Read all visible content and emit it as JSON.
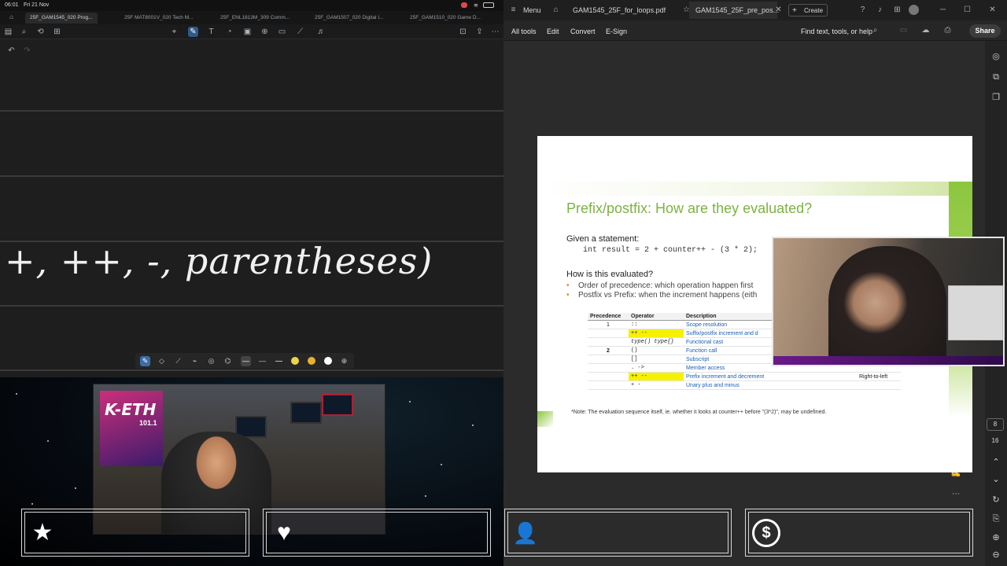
{
  "ipad": {
    "status": {
      "time": "06:01",
      "date": "Fri 21 Nov"
    },
    "tabs": [
      "25F_GAM1545_020 Prog...",
      "25F MAT8001V_020 Tech M...",
      "25F_ENL1813M_309 Comm...",
      "25F_GAM1507_020 Digital I...",
      "25F_GAM1510_020 Game D..."
    ],
    "handwriting": "+, ++, -, parentheses)",
    "pen_colors": [
      "#f0d24a",
      "#e6b030",
      "#ffffff"
    ]
  },
  "stream": {
    "radio_logo": "K-ETH",
    "radio_freq": "101.1",
    "cards": [
      {
        "icon": "star-icon",
        "glyph": "★"
      },
      {
        "icon": "heart-icon",
        "glyph": "♥"
      },
      {
        "icon": "add-user-icon",
        "glyph": "👤"
      },
      {
        "icon": "dollar-icon",
        "glyph": "$"
      }
    ]
  },
  "pdf": {
    "menu_label": "Menu",
    "tabs": [
      "GAM1545_25F_for_loops.pdf",
      "GAM1545_25F_pre_pos..."
    ],
    "create_label": "Create",
    "menubar": [
      "All tools",
      "Edit",
      "Convert",
      "E-Sign"
    ],
    "find_label": "Find text, tools, or help",
    "share_label": "Share",
    "page_current": "8",
    "page_total": "16"
  },
  "slide": {
    "title": "Prefix/postfix: How are they evaluated?",
    "given": "Given a statement:",
    "code": "int result = 2 + counter++ - (3 * 2);",
    "how": "How is this evaluated?",
    "bullets": [
      "Order of precedence: which operation happen first",
      "Postfix vs Prefix: when the increment happens (eith"
    ],
    "table_headers": [
      "Precedence",
      "Operator",
      "Description",
      ""
    ],
    "table_rows": [
      [
        "1",
        "::",
        "Scope resolution",
        ""
      ],
      [
        "",
        "++ --",
        "Suffix/postfix increment and d",
        ""
      ],
      [
        "",
        "type() type{}",
        "Functional cast",
        ""
      ],
      [
        "2",
        "()",
        "Function call",
        ""
      ],
      [
        "",
        "[]",
        "Subscript",
        ""
      ],
      [
        "",
        ". ->",
        "Member access",
        ""
      ],
      [
        "",
        "++ --",
        "Prefix increment and decrement",
        "Right-to-left"
      ],
      [
        "",
        "+ -",
        "Unary plus and minus",
        ""
      ]
    ],
    "note": "*Note: The evaluation sequence itself, ie. whether it looks at counter++ before \"(3*2)\", may be undefined."
  }
}
